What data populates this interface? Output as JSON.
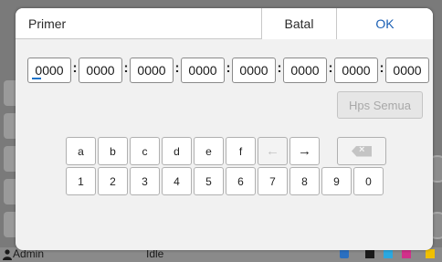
{
  "dialog": {
    "title": "Primer",
    "cancel_label": "Batal",
    "ok_label": "OK"
  },
  "fields": [
    "0000",
    "0000",
    "0000",
    "0000",
    "0000",
    "0000",
    "0000",
    "0000"
  ],
  "separator": ":",
  "clear_label": "Hps Semua",
  "keypad": {
    "row1": [
      "a",
      "b",
      "c",
      "d",
      "e",
      "f"
    ],
    "arrow_left": "←",
    "arrow_right": "→",
    "backspace": "⌫",
    "row2": [
      "1",
      "2",
      "3",
      "4",
      "5",
      "6",
      "7",
      "8",
      "9",
      "0"
    ]
  },
  "statusbar": {
    "user": "Admin",
    "state": "Idle"
  },
  "colors": {
    "accent": "#1a5fb4",
    "cursor": "#1a73c9",
    "dialog_bg": "#f1f1f1"
  }
}
